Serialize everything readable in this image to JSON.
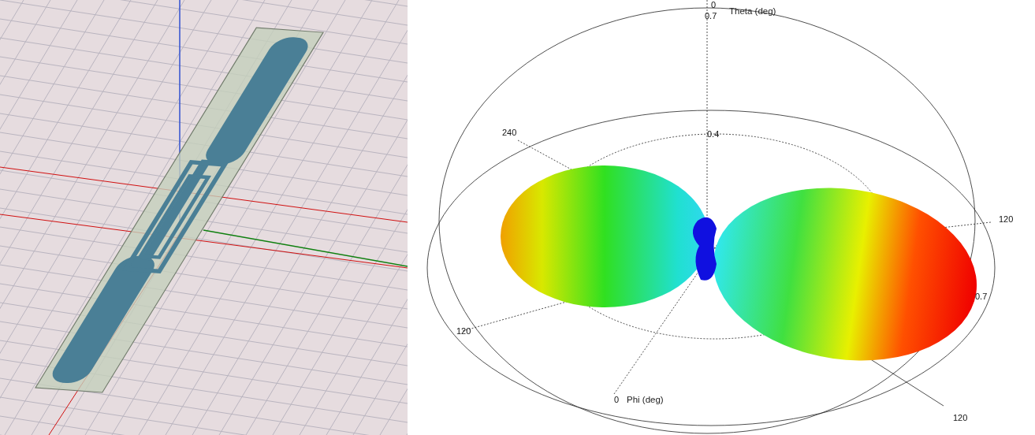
{
  "radiation_pattern": {
    "labels": [
      {
        "text": "0",
        "kind": "tick"
      },
      {
        "text": "0.7",
        "kind": "tick"
      },
      {
        "text": "Theta (deg)",
        "kind": "axis"
      },
      {
        "text": "240",
        "kind": "tick"
      },
      {
        "text": "0.4",
        "kind": "tick"
      },
      {
        "text": "120",
        "kind": "tick"
      },
      {
        "text": "0.7",
        "kind": "tick"
      },
      {
        "text": "120",
        "kind": "tick"
      },
      {
        "text": "0",
        "kind": "tick"
      },
      {
        "text": "Phi (deg)",
        "kind": "axis"
      },
      {
        "text": "120",
        "kind": "tick"
      }
    ]
  }
}
